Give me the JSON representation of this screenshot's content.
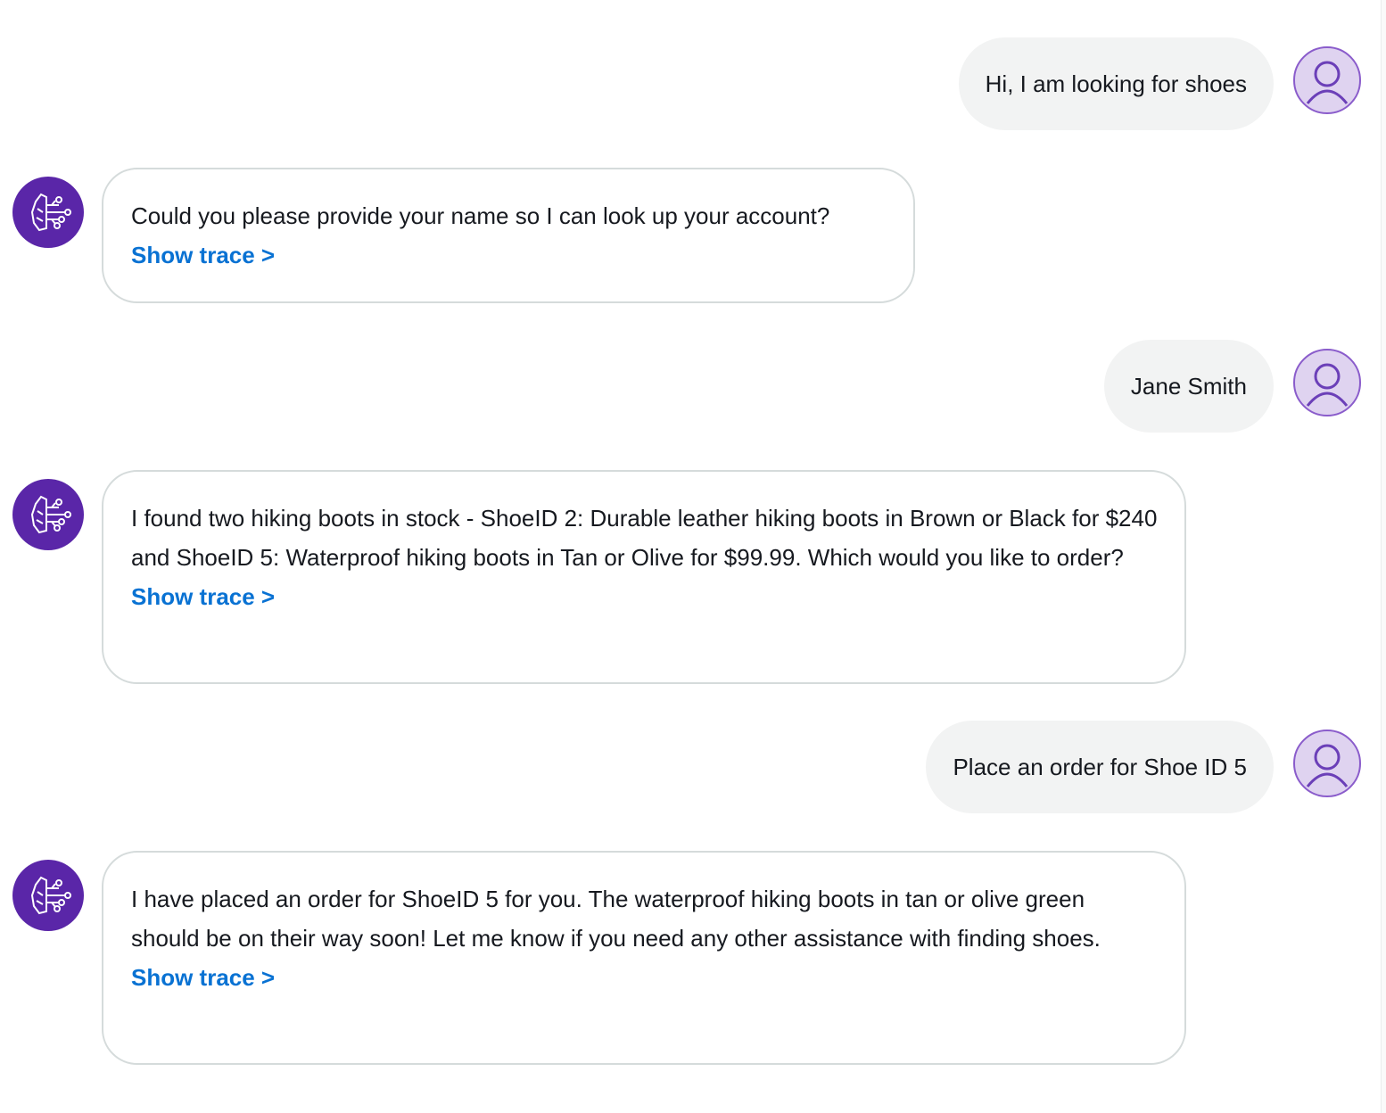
{
  "conversation": {
    "messages": [
      {
        "role": "user",
        "text": "Hi, I am looking for shoes",
        "avatar_icon": "user-icon"
      },
      {
        "role": "assistant",
        "text": "Could you please provide your name so I can look up your account?",
        "trace_label": "Show trace >",
        "avatar_icon": "ai-brain-icon"
      },
      {
        "role": "user",
        "text": "Jane Smith",
        "avatar_icon": "user-icon"
      },
      {
        "role": "assistant",
        "text": "I found two hiking boots in stock - ShoeID 2: Durable leather hiking boots in Brown or Black for $240 and ShoeID 5: Waterproof hiking boots in Tan or Olive for $99.99. Which would you like to order?",
        "trace_label": "Show trace >",
        "avatar_icon": "ai-brain-icon"
      },
      {
        "role": "user",
        "text": "Place an order for Shoe ID 5",
        "avatar_icon": "user-icon"
      },
      {
        "role": "assistant",
        "text": "I have placed an order for ShoeID 5 for you. The waterproof hiking boots in tan or olive green should be on their way soon! Let me know if you need any other assistance with finding shoes.",
        "trace_label": "Show trace >",
        "avatar_icon": "ai-brain-icon"
      }
    ]
  },
  "colors": {
    "bot_avatar": "#5a26a8",
    "user_avatar_bg": "#dfd3f0",
    "user_avatar_stroke": "#6b3fb8",
    "link": "#0972d3",
    "user_bubble": "#f2f3f3"
  }
}
